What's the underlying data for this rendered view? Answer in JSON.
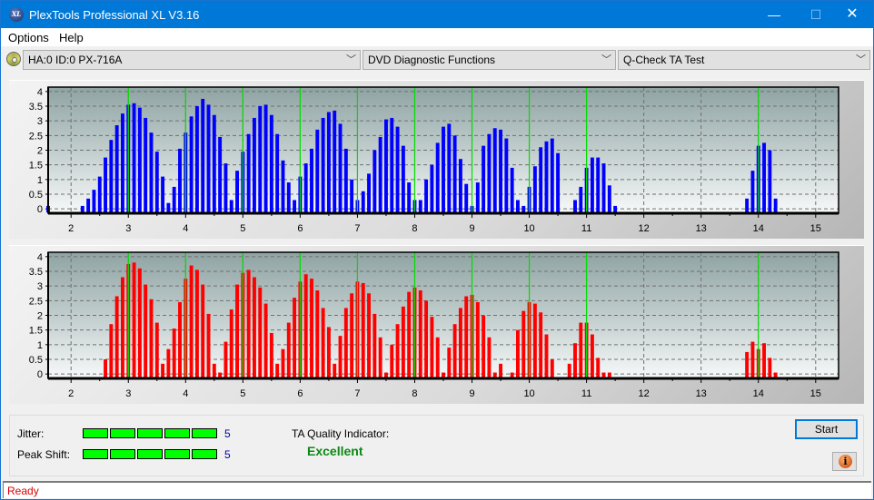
{
  "window": {
    "title": "PlexTools Professional XL V3.16",
    "app_icon_text": "XL",
    "controls": {
      "minimize": "—",
      "maximize": "☐",
      "close": "✕"
    }
  },
  "menu": {
    "items": [
      {
        "label": "Options"
      },
      {
        "label": "Help"
      }
    ]
  },
  "toolbar": {
    "drive_select": {
      "value": "HA:0 ID:0  PX-716A",
      "icon": "disc-icon"
    },
    "function_select": {
      "value": "DVD Diagnostic Functions"
    },
    "test_select": {
      "value": "Q-Check TA Test"
    },
    "dropdown_arrow": "﹀"
  },
  "colors": {
    "top_bars": "#0000ff",
    "bottom_bars": "#ff0000",
    "reference_lines": "#00dd00",
    "quality_text": "#0a8a12",
    "status_text": "#e00000",
    "meter_fill": "#00ff00"
  },
  "chart_data": [
    {
      "type": "bar",
      "name": "top-chart",
      "title": "",
      "xlabel": "",
      "ylabel": "",
      "xlim": [
        1.6,
        15.4
      ],
      "ylim": [
        -0.15,
        4.15
      ],
      "x_ticks": [
        2,
        3,
        4,
        5,
        6,
        7,
        8,
        9,
        10,
        11,
        12,
        13,
        14,
        15
      ],
      "y_ticks": [
        0,
        0.5,
        1,
        1.5,
        2,
        2.5,
        3,
        3.5,
        4
      ],
      "y_tick_labels": [
        "0",
        "0.5",
        "1",
        "1.5",
        "2",
        "2.5",
        "3",
        "3.5",
        "4"
      ],
      "grid": true,
      "reference_lines_x": [
        3,
        4,
        5,
        6,
        7,
        8,
        9,
        10,
        11,
        14
      ],
      "bar_color": "#0000ff",
      "x": [
        1.6,
        2.2,
        2.3,
        2.4,
        2.5,
        2.6,
        2.7,
        2.8,
        2.9,
        3.0,
        3.1,
        3.2,
        3.3,
        3.4,
        3.5,
        3.6,
        3.7,
        3.8,
        3.9,
        4.0,
        4.1,
        4.2,
        4.3,
        4.4,
        4.5,
        4.6,
        4.7,
        4.8,
        4.9,
        5.0,
        5.1,
        5.2,
        5.3,
        5.4,
        5.5,
        5.6,
        5.7,
        5.8,
        5.9,
        6.0,
        6.1,
        6.2,
        6.3,
        6.4,
        6.5,
        6.6,
        6.7,
        6.8,
        6.9,
        7.0,
        7.1,
        7.2,
        7.3,
        7.4,
        7.5,
        7.6,
        7.7,
        7.8,
        7.9,
        8.0,
        8.1,
        8.2,
        8.3,
        8.4,
        8.5,
        8.6,
        8.7,
        8.8,
        8.9,
        9.0,
        9.1,
        9.2,
        9.3,
        9.4,
        9.5,
        9.6,
        9.7,
        9.8,
        9.9,
        10.0,
        10.1,
        10.2,
        10.3,
        10.4,
        10.5,
        10.8,
        10.9,
        11.0,
        11.1,
        11.2,
        11.3,
        11.4,
        11.5,
        13.8,
        13.9,
        14.0,
        14.1,
        14.2,
        14.3
      ],
      "values": [
        0.1,
        0.1,
        0.35,
        0.65,
        1.1,
        1.75,
        2.35,
        2.85,
        3.25,
        3.55,
        3.6,
        3.45,
        3.1,
        2.6,
        1.95,
        1.1,
        0.2,
        0.75,
        2.05,
        2.6,
        3.15,
        3.5,
        3.75,
        3.55,
        3.2,
        2.45,
        1.55,
        0.3,
        1.3,
        1.95,
        2.55,
        3.1,
        3.5,
        3.55,
        3.2,
        2.55,
        1.65,
        0.9,
        0.3,
        1.1,
        1.55,
        2.05,
        2.7,
        3.1,
        3.3,
        3.35,
        2.9,
        2.05,
        1.0,
        0.3,
        0.6,
        1.2,
        2.0,
        2.45,
        3.05,
        3.1,
        2.8,
        2.15,
        0.9,
        0.3,
        0.3,
        1.0,
        1.5,
        2.25,
        2.8,
        2.9,
        2.5,
        1.7,
        0.85,
        0.1,
        0.9,
        2.15,
        2.55,
        2.75,
        2.7,
        2.4,
        1.4,
        0.3,
        0.1,
        0.75,
        1.45,
        2.1,
        2.3,
        2.4,
        1.9,
        0.3,
        0.75,
        1.4,
        1.75,
        1.75,
        1.55,
        0.8,
        0.1,
        0.35,
        1.3,
        2.15,
        2.25,
        2.0,
        0.35
      ]
    },
    {
      "type": "bar",
      "name": "bottom-chart",
      "title": "",
      "xlabel": "",
      "ylabel": "",
      "xlim": [
        1.6,
        15.4
      ],
      "ylim": [
        -0.15,
        4.15
      ],
      "x_ticks": [
        2,
        3,
        4,
        5,
        6,
        7,
        8,
        9,
        10,
        11,
        12,
        13,
        14,
        15
      ],
      "y_ticks": [
        0,
        0.5,
        1,
        1.5,
        2,
        2.5,
        3,
        3.5,
        4
      ],
      "y_tick_labels": [
        "0",
        "0.5",
        "1",
        "1.5",
        "2",
        "2.5",
        "3",
        "3.5",
        "4"
      ],
      "grid": true,
      "reference_lines_x": [
        3,
        4,
        5,
        6,
        7,
        8,
        9,
        10,
        11,
        14
      ],
      "bar_color": "#ff0000",
      "x": [
        2.6,
        2.7,
        2.8,
        2.9,
        3.0,
        3.1,
        3.2,
        3.3,
        3.4,
        3.5,
        3.6,
        3.7,
        3.8,
        3.9,
        4.0,
        4.1,
        4.2,
        4.3,
        4.4,
        4.5,
        4.6,
        4.7,
        4.8,
        4.9,
        5.0,
        5.1,
        5.2,
        5.3,
        5.4,
        5.5,
        5.6,
        5.7,
        5.8,
        5.9,
        6.0,
        6.1,
        6.2,
        6.3,
        6.4,
        6.5,
        6.6,
        6.7,
        6.8,
        6.9,
        7.0,
        7.1,
        7.2,
        7.3,
        7.4,
        7.5,
        7.6,
        7.7,
        7.8,
        7.9,
        8.0,
        8.1,
        8.2,
        8.3,
        8.4,
        8.5,
        8.6,
        8.7,
        8.8,
        8.9,
        9.0,
        9.1,
        9.2,
        9.3,
        9.4,
        9.5,
        9.7,
        9.8,
        9.9,
        10.0,
        10.1,
        10.2,
        10.3,
        10.4,
        10.7,
        10.8,
        10.9,
        11.0,
        11.1,
        11.2,
        11.3,
        11.4,
        13.8,
        13.9,
        14.0,
        14.1,
        14.2,
        14.3
      ],
      "values": [
        0.5,
        1.7,
        2.65,
        3.3,
        3.75,
        3.8,
        3.6,
        3.05,
        2.55,
        1.75,
        0.35,
        0.85,
        1.55,
        2.45,
        3.25,
        3.7,
        3.55,
        3.05,
        2.05,
        0.35,
        0.05,
        1.1,
        2.2,
        3.05,
        3.45,
        3.55,
        3.3,
        2.95,
        2.4,
        1.4,
        0.35,
        0.85,
        1.75,
        2.6,
        3.15,
        3.4,
        3.25,
        2.85,
        2.25,
        1.6,
        0.35,
        1.3,
        2.25,
        2.75,
        3.15,
        3.1,
        2.75,
        2.05,
        1.25,
        0.05,
        1.0,
        1.7,
        2.3,
        2.8,
        2.95,
        2.85,
        2.5,
        1.95,
        1.25,
        0.05,
        0.9,
        1.7,
        2.25,
        2.65,
        2.7,
        2.45,
        2.0,
        1.25,
        0.05,
        0.35,
        0.05,
        1.5,
        2.15,
        2.45,
        2.4,
        2.1,
        1.35,
        0.5,
        0.35,
        1.05,
        1.75,
        1.75,
        1.35,
        0.55,
        0.05,
        0.05,
        0.75,
        1.1,
        0.85,
        1.05,
        0.55,
        0.05
      ]
    }
  ],
  "results": {
    "jitter": {
      "label": "Jitter:",
      "value": "5",
      "level": 5,
      "max_level": 5
    },
    "peak_shift": {
      "label": "Peak Shift:",
      "value": "5",
      "level": 5,
      "max_level": 5
    },
    "ta_quality": {
      "label": "TA Quality Indicator:",
      "value": "Excellent"
    }
  },
  "buttons": {
    "start": "Start",
    "info_icon": "i"
  },
  "status": {
    "text": "Ready"
  }
}
